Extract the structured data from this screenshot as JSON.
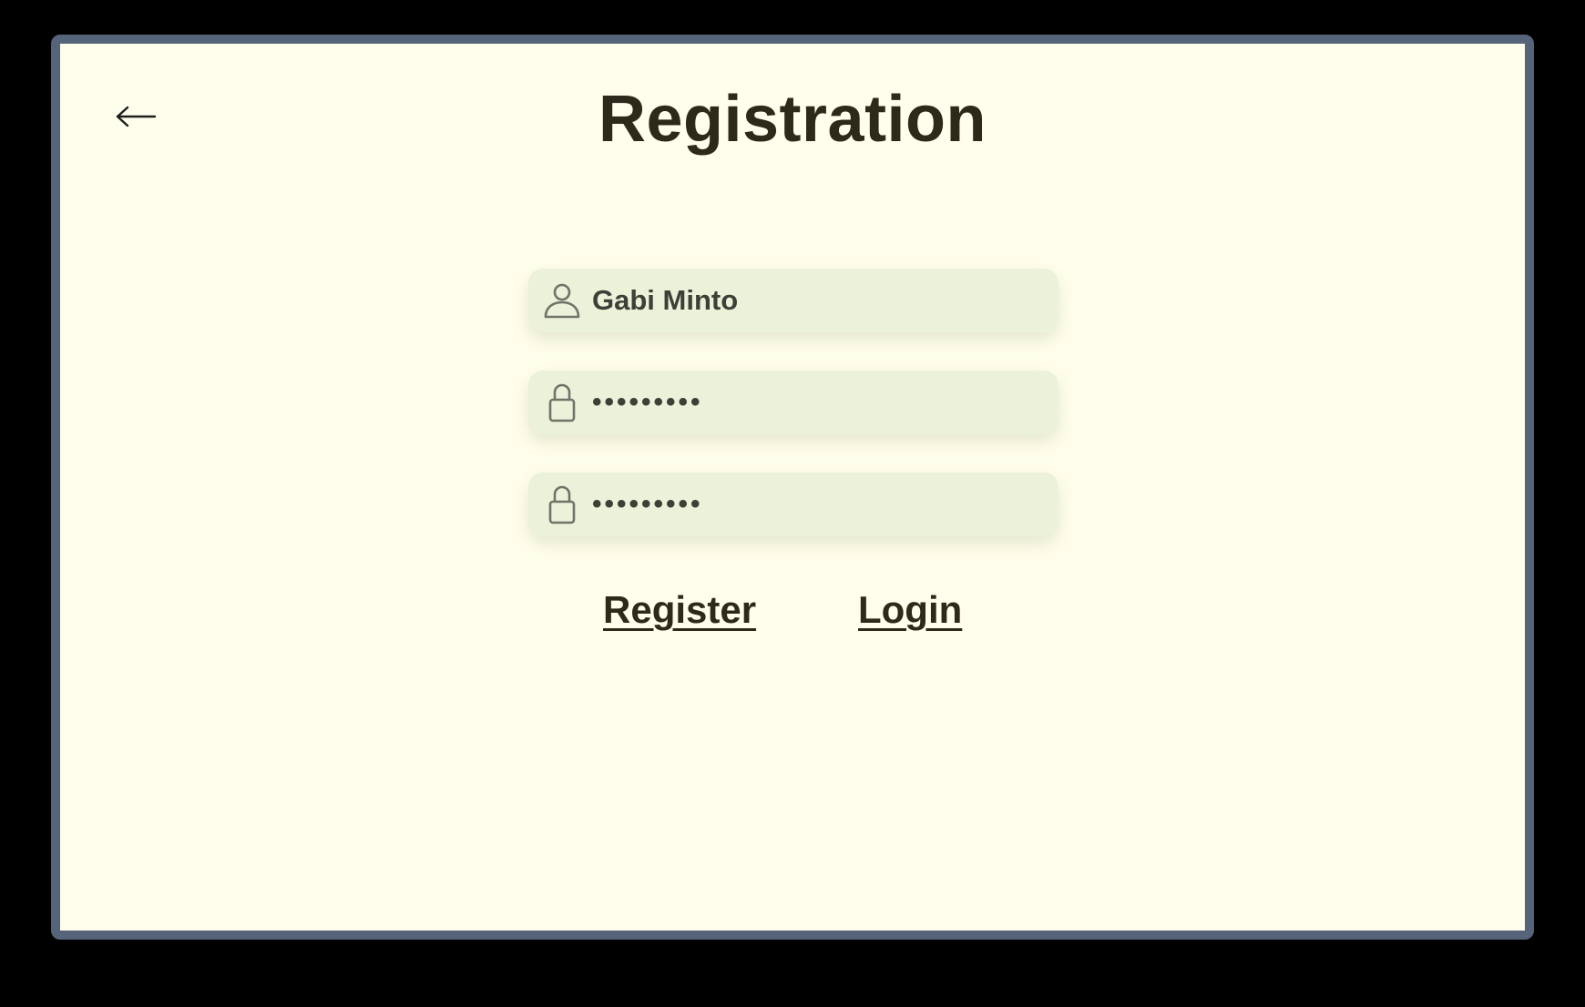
{
  "page": {
    "title": "Registration",
    "back_icon": "arrow-left-icon"
  },
  "form": {
    "username": {
      "icon": "user-icon",
      "value": "Gabi Minto"
    },
    "password": {
      "icon": "lock-icon",
      "value": "•••••••••"
    },
    "confirm_password": {
      "icon": "lock-icon",
      "value": "•••••••••"
    }
  },
  "actions": {
    "register_label": "Register",
    "login_label": "Login"
  },
  "colors": {
    "background": "#fffeec",
    "frame_border": "#56647a",
    "field_background": "#ecf1d9",
    "text": "#2d2a1c"
  }
}
